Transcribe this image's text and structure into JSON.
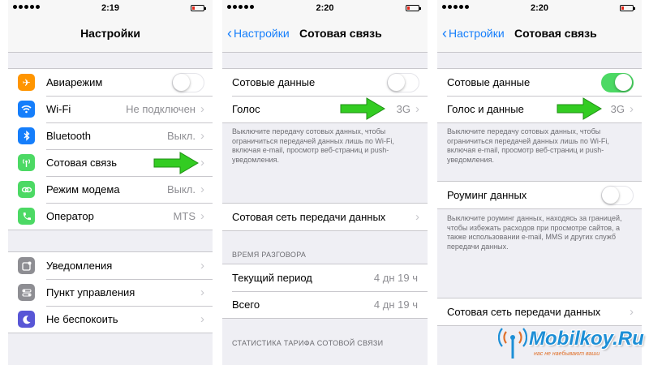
{
  "colors": {
    "ios_blue": "#157efb",
    "toggle_on": "#4cd964",
    "arrow_green": "#33cc22",
    "logo_blue": "#1d8fd6"
  },
  "screen1": {
    "time": "2:19",
    "title": "Настройки",
    "group1": [
      {
        "label": "Авиарежим",
        "icon": "airplane-icon",
        "color": "#ff9500",
        "accessory": "toggle-off"
      },
      {
        "label": "Wi-Fi",
        "value": "Не подключен",
        "icon": "wifi-icon",
        "color": "#157efb"
      },
      {
        "label": "Bluetooth",
        "value": "Выкл.",
        "icon": "bluetooth-icon",
        "color": "#157efb"
      },
      {
        "label": "Сотовая связь",
        "icon": "cellular-icon",
        "color": "#4cd964"
      },
      {
        "label": "Режим модема",
        "value": "Выкл.",
        "icon": "hotspot-icon",
        "color": "#4cd964"
      },
      {
        "label": "Оператор",
        "value": "MTS",
        "icon": "phone-icon",
        "color": "#4cd964"
      }
    ],
    "group2": [
      {
        "label": "Уведомления",
        "icon": "notifications-icon",
        "color": "#8e8e93"
      },
      {
        "label": "Пункт управления",
        "icon": "control-center-icon",
        "color": "#8e8e93"
      },
      {
        "label": "Не беспокоить",
        "icon": "moon-icon",
        "color": "#5856d6"
      }
    ]
  },
  "screen2": {
    "time": "2:20",
    "back": "Настройки",
    "title": "Сотовая связь",
    "cellular_data": "Сотовые данные",
    "voice": "Голос",
    "voice_value": "3G",
    "note": "Выключите передачу сотовых данных, чтобы ограничиться передачей данных лишь по Wi-Fi, включая e-mail, просмотр веб-страниц и push-уведомления.",
    "network": "Сотовая сеть передачи данных",
    "call_time_header": "ВРЕМЯ РАЗГОВОРА",
    "current_period": "Текущий период",
    "current_period_value": "4 дн 19 ч",
    "total": "Всего",
    "total_value": "4 дн 19 ч",
    "stats_header": "СТАТИСТИКА ТАРИФА СОТОВОЙ СВЯЗИ"
  },
  "screen3": {
    "time": "2:20",
    "back": "Настройки",
    "title": "Сотовая связь",
    "cellular_data": "Сотовые данные",
    "voice_data": "Голос и данные",
    "voice_value": "3G",
    "note": "Выключите передачу сотовых данных, чтобы ограничиться передачей данных лишь по Wi-Fi, включая e-mail, просмотр веб-страниц и push-уведомления.",
    "roaming": "Роуминг данных",
    "roaming_note": "Выключите роуминг данных, находясь за границей, чтобы избежать расходов при просмотре сайтов, а также использовании e-mail, MMS и других служб передачи данных.",
    "network": "Сотовая сеть передачи данных"
  },
  "watermark": {
    "text": "Mobilkoy.Ru",
    "sub": "нас не наебывают ваши"
  }
}
